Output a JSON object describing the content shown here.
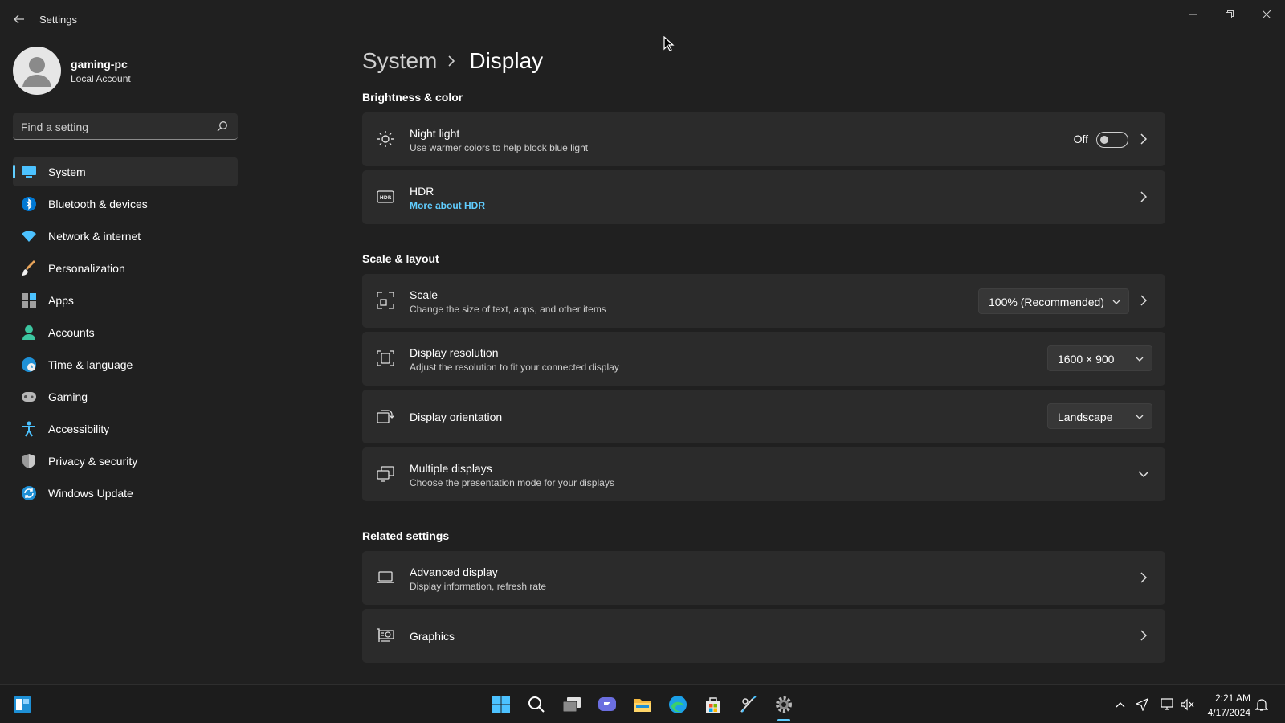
{
  "window": {
    "title": "Settings"
  },
  "profile": {
    "name": "gaming-pc",
    "account_type": "Local Account"
  },
  "search": {
    "placeholder": "Find a setting"
  },
  "sidebar": {
    "items": [
      {
        "label": "System",
        "icon": "monitor-icon",
        "active": true
      },
      {
        "label": "Bluetooth & devices",
        "icon": "bluetooth-icon"
      },
      {
        "label": "Network & internet",
        "icon": "wifi-icon"
      },
      {
        "label": "Personalization",
        "icon": "brush-icon"
      },
      {
        "label": "Apps",
        "icon": "apps-icon"
      },
      {
        "label": "Accounts",
        "icon": "person-icon"
      },
      {
        "label": "Time & language",
        "icon": "globe-clock-icon"
      },
      {
        "label": "Gaming",
        "icon": "gamepad-icon"
      },
      {
        "label": "Accessibility",
        "icon": "accessibility-icon"
      },
      {
        "label": "Privacy & security",
        "icon": "shield-icon"
      },
      {
        "label": "Windows Update",
        "icon": "update-icon"
      }
    ]
  },
  "breadcrumb": {
    "parent": "System",
    "current": "Display"
  },
  "sections": {
    "brightness": "Brightness & color",
    "scale_layout": "Scale & layout",
    "related": "Related settings"
  },
  "cards": {
    "night_light": {
      "title": "Night light",
      "subtitle": "Use warmer colors to help block blue light",
      "state_label": "Off"
    },
    "hdr": {
      "title": "HDR",
      "link": "More about HDR"
    },
    "scale": {
      "title": "Scale",
      "subtitle": "Change the size of text, apps, and other items",
      "value": "100% (Recommended)"
    },
    "resolution": {
      "title": "Display resolution",
      "subtitle": "Adjust the resolution to fit your connected display",
      "value": "1600 × 900"
    },
    "orientation": {
      "title": "Display orientation",
      "value": "Landscape"
    },
    "multiple": {
      "title": "Multiple displays",
      "subtitle": "Choose the presentation mode for your displays"
    },
    "advanced": {
      "title": "Advanced display",
      "subtitle": "Display information, refresh rate"
    },
    "graphics": {
      "title": "Graphics"
    }
  },
  "taskbar": {
    "time": "2:21 AM",
    "date": "4/17/2024"
  },
  "colors": {
    "accent": "#60cdff",
    "background": "#202020",
    "card": "#2b2b2b"
  }
}
